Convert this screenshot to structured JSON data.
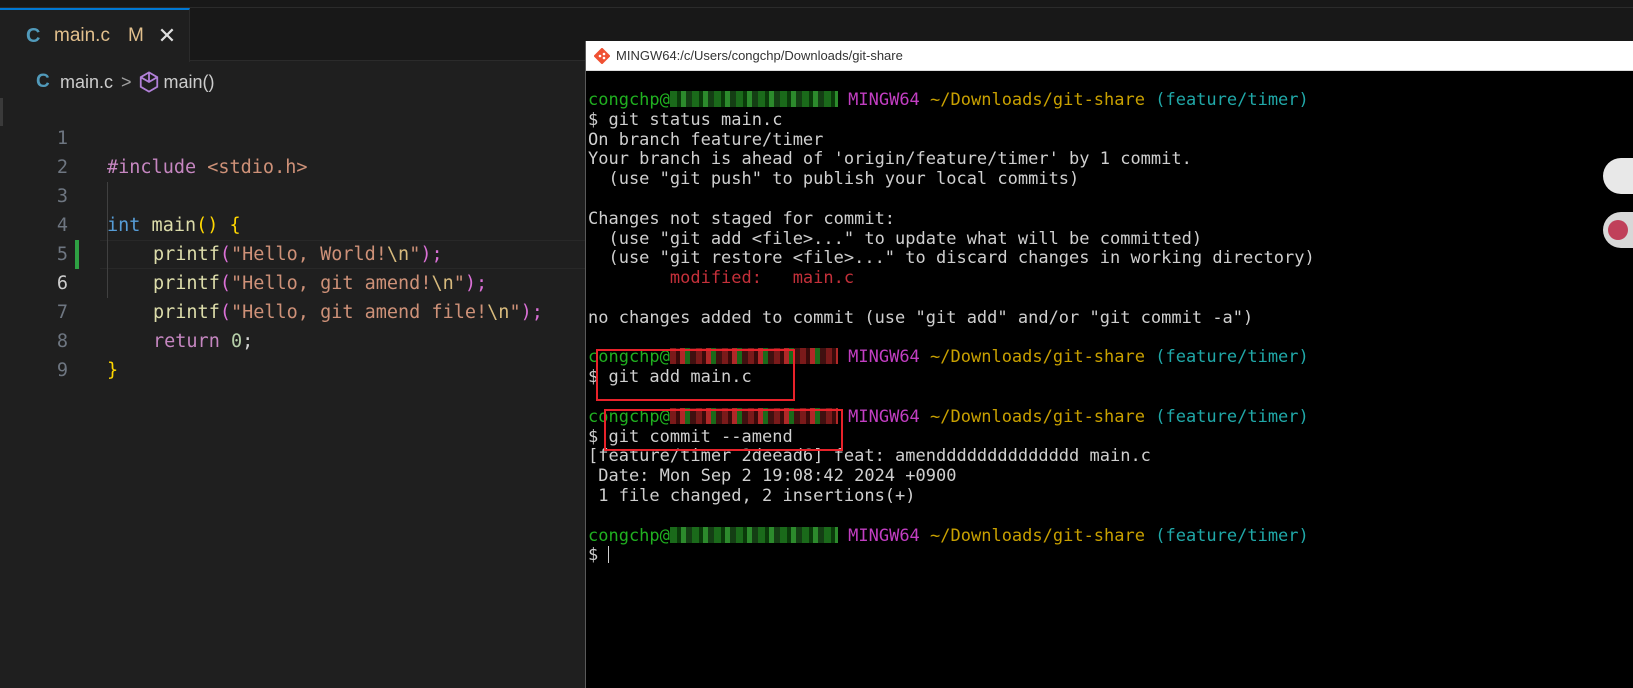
{
  "editor": {
    "tab": {
      "icon": "c-language-icon",
      "filename": "main.c",
      "status": "M",
      "close": "✕"
    },
    "breadcrumb": {
      "file": "main.c",
      "separator": ">",
      "symbol": "main()"
    },
    "line_numbers": [
      "1",
      "2",
      "3",
      "4",
      "5",
      "6",
      "7",
      "8",
      "9"
    ],
    "code": {
      "l1_directive": "#include",
      "l1_header": " <stdio.h>",
      "l3_type": "int",
      "l3_fn": " main",
      "l3_paren": "()",
      "l3_brace": " {",
      "l4_fn": "printf",
      "l4_open": "(",
      "l4_str": "\"Hello, World!",
      "l4_esc": "\\n",
      "l4_close_str": "\"",
      "l4_close": ");",
      "l5_fn": "printf",
      "l5_open": "(",
      "l5_str": "\"Hello, git amend!",
      "l5_esc": "\\n",
      "l5_close_str": "\"",
      "l5_close": ");",
      "l6_fn": "printf",
      "l6_open": "(",
      "l6_str": "\"Hello, git amend file!",
      "l6_esc": "\\n",
      "l6_close_str": "\"",
      "l6_close": ");",
      "l7_kw": "return",
      "l7_num": " 0",
      "l7_semi": ";",
      "l8_brace": "}"
    }
  },
  "terminal": {
    "title": "MINGW64:/c/Users/congchp/Downloads/git-share",
    "prompt_user": "congchp@",
    "prompt_env": "MINGW64",
    "prompt_path": "~/Downloads/git-share",
    "prompt_branch": "(feature/timer)",
    "cmd1": "$ git status main.c",
    "out1": "On branch feature/timer",
    "out2": "Your branch is ahead of 'origin/feature/timer' by 1 commit.",
    "out3": "  (use \"git push\" to publish your local commits)",
    "out4": "Changes not staged for commit:",
    "out5": "  (use \"git add <file>...\" to update what will be committed)",
    "out6": "  (use \"git restore <file>...\" to discard changes in working directory)",
    "out7_label": "        modified:   main.c",
    "out8": "no changes added to commit (use \"git add\" and/or \"git commit -a\")",
    "cmd2": "$ git add main.c",
    "cmd3": "$ git commit --amend",
    "out9": "[feature/timer 2deead6] feat: amendddddddddddddd main.c",
    "out10": " Date: Mon Sep 2 19:08:42 2024 +0900",
    "out11": " 1 file changed, 2 insertions(+)",
    "cmd4": "$ "
  }
}
